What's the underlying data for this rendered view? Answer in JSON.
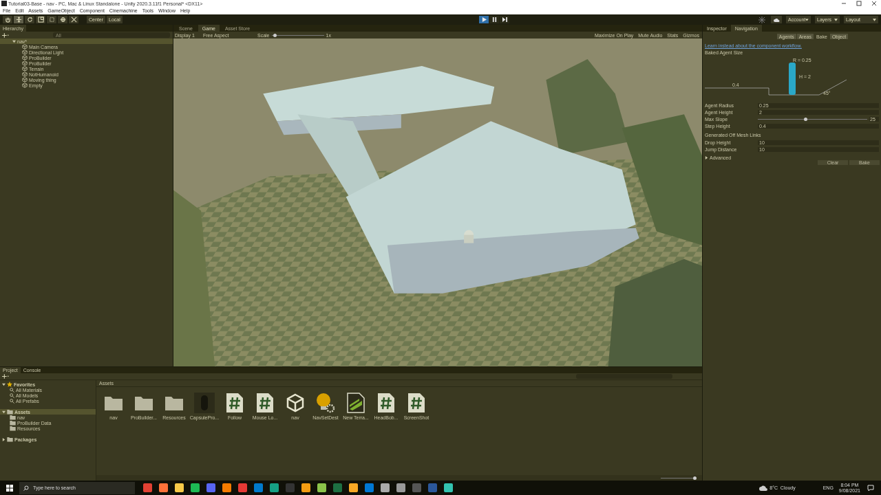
{
  "window": {
    "title": "Tutorial03-Base - nav - PC, Mac & Linux Standalone - Unity 2020.3.11f1 Personal* <DX11>"
  },
  "menu": [
    "File",
    "Edit",
    "Assets",
    "GameObject",
    "Component",
    "Cinemachine",
    "Tools",
    "Window",
    "Help"
  ],
  "toolbar": {
    "tools": [
      {
        "kind": "hand",
        "selected": false
      },
      {
        "kind": "move",
        "selected": true
      },
      {
        "kind": "rotate",
        "selected": false
      },
      {
        "kind": "scale",
        "selected": false
      },
      {
        "kind": "rect",
        "selected": false
      },
      {
        "kind": "transform",
        "selected": false
      },
      {
        "kind": "custom",
        "selected": false
      }
    ],
    "pivot": [
      "Center",
      "Local"
    ],
    "play_controls": [
      {
        "kind": "play",
        "on": true
      },
      {
        "kind": "pause",
        "on": false
      },
      {
        "kind": "step",
        "on": false
      }
    ],
    "right": [
      "Account",
      "Layers",
      "Layout"
    ]
  },
  "hierarchy": {
    "tab": "Hierarchy",
    "search_placeholder": "All",
    "scene": {
      "name": "nav*",
      "expanded": true,
      "selected": true
    },
    "objects": [
      "Main Camera",
      "Directional Light",
      "ProBuilder",
      "ProBuilder",
      "Terrain",
      "NotHumanoid",
      "Moving thing",
      "Empty"
    ]
  },
  "game": {
    "tabs": [
      {
        "label": "Scene",
        "selected": false
      },
      {
        "label": "Game",
        "selected": true
      },
      {
        "label": "Asset Store",
        "selected": false
      }
    ],
    "display": "Display 1",
    "aspect": "Free Aspect",
    "scale_label": "Scale",
    "scale": {
      "level": 0.03
    },
    "scale_value": "1x",
    "toggles": [
      "Maximize On Play",
      "Mute Audio",
      "Stats",
      "Gizmos"
    ]
  },
  "inspector": {
    "tabs": [
      {
        "label": "Inspector",
        "selected": false
      },
      {
        "label": "Navigation",
        "selected": true
      }
    ],
    "subtabs": [
      {
        "label": "Agents",
        "selected": false
      },
      {
        "label": "Areas",
        "selected": false
      },
      {
        "label": "Bake",
        "selected": true
      },
      {
        "label": "Object",
        "selected": false
      }
    ],
    "link": "Learn instead about the component workflow.",
    "section": "Baked Agent Size",
    "diagram": {
      "radius": "R = 0.25",
      "height": "H = 2",
      "step": "0.4",
      "slope": "45°"
    },
    "fields": [
      {
        "kind": "text",
        "label": "Agent Radius",
        "value": "0.25"
      },
      {
        "kind": "text",
        "label": "Agent Height",
        "value": "2"
      },
      {
        "kind": "slider",
        "label": "Max Slope",
        "value": "25",
        "level": 0.42
      },
      {
        "kind": "text",
        "label": "Step Height",
        "value": "0.4"
      }
    ],
    "links_section": "Generated Off Mesh Links",
    "link_fields": [
      {
        "label": "Drop Height",
        "value": "10"
      },
      {
        "label": "Jump Distance",
        "value": "10"
      }
    ],
    "advanced": {
      "label": "Advanced",
      "expanded": false
    },
    "buttons": [
      "Clear",
      "Bake"
    ]
  },
  "project": {
    "tabs": [
      {
        "label": "Project",
        "selected": true
      },
      {
        "label": "Console",
        "selected": false
      }
    ],
    "tree": [
      {
        "label": "Favorites",
        "kind": "favorites",
        "expanded": true,
        "children": [
          {
            "label": "All Materials",
            "kind": "search"
          },
          {
            "label": "All Models",
            "kind": "search"
          },
          {
            "label": "All Prefabs",
            "kind": "search"
          }
        ]
      },
      {
        "label": "Assets",
        "kind": "folder",
        "expanded": true,
        "selected": true,
        "children": [
          {
            "label": "nav",
            "kind": "folder"
          },
          {
            "label": "ProBuilder Data",
            "kind": "folder"
          },
          {
            "label": "Resources",
            "kind": "folder"
          }
        ]
      },
      {
        "label": "Packages",
        "kind": "folder",
        "expanded": false
      }
    ],
    "breadcrumb": "Assets",
    "assets": [
      {
        "kind": "folder",
        "label": "nav"
      },
      {
        "kind": "folder",
        "label": "ProBuilder..."
      },
      {
        "kind": "folder",
        "label": "Resources"
      },
      {
        "kind": "model",
        "label": "CapsulePro..."
      },
      {
        "kind": "script",
        "label": "Follow"
      },
      {
        "kind": "script",
        "label": "Mouse Lo..."
      },
      {
        "kind": "scene",
        "label": "nav"
      },
      {
        "kind": "lighting",
        "label": "NavSetDest"
      },
      {
        "kind": "terrain",
        "label": "New Terra..."
      },
      {
        "kind": "script",
        "label": "HeadBob..."
      },
      {
        "kind": "script",
        "label": "ScreenShot"
      }
    ],
    "icon_size": {
      "level": 0.93
    }
  },
  "taskbar": {
    "search_placeholder": "Type here to search",
    "weather": "8°C  Cloudy",
    "language": "ENG",
    "time": "8:04 PM",
    "date": "9/08/2021"
  }
}
